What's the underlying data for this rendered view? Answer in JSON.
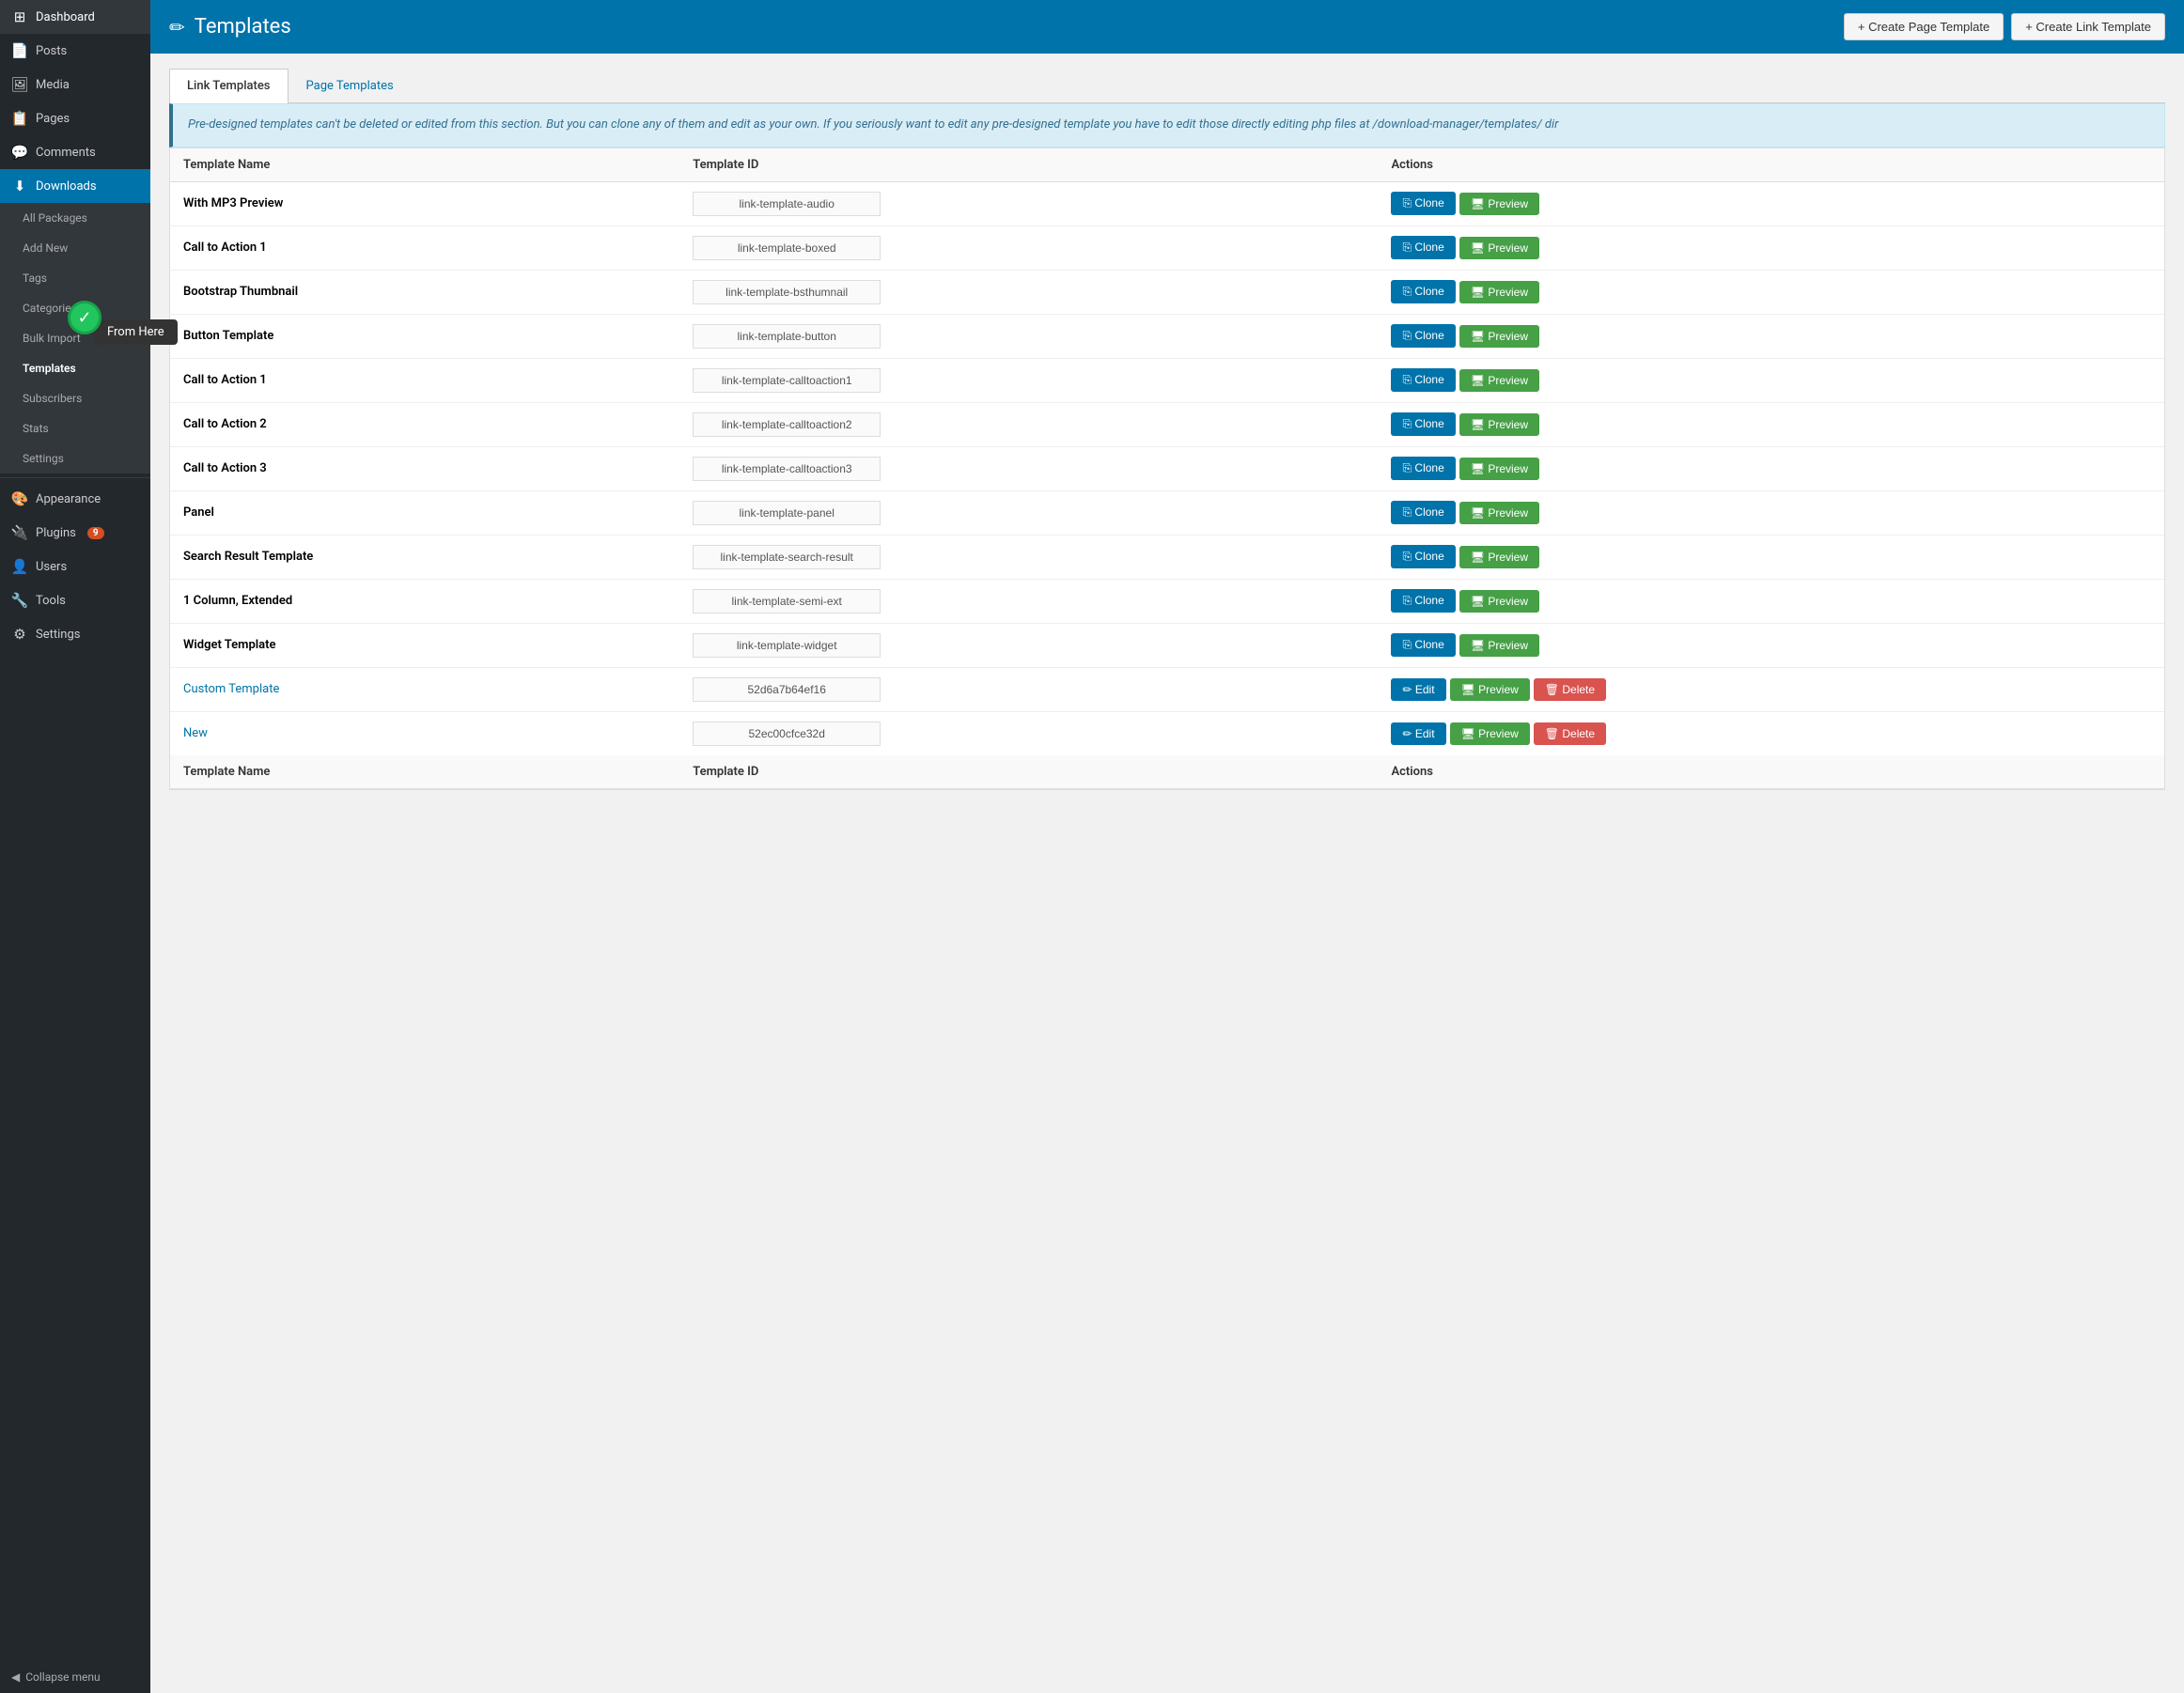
{
  "sidebar": {
    "items": [
      {
        "id": "dashboard",
        "label": "Dashboard",
        "icon": "⊞",
        "active": false
      },
      {
        "id": "posts",
        "label": "Posts",
        "icon": "📄",
        "active": false
      },
      {
        "id": "media",
        "label": "Media",
        "icon": "🖼",
        "active": false
      },
      {
        "id": "pages",
        "label": "Pages",
        "icon": "📋",
        "active": false
      },
      {
        "id": "comments",
        "label": "Comments",
        "icon": "💬",
        "active": false
      },
      {
        "id": "downloads",
        "label": "Downloads",
        "icon": "⬇",
        "active": true
      }
    ],
    "downloads_submenu": [
      {
        "id": "all-packages",
        "label": "All Packages"
      },
      {
        "id": "add-new",
        "label": "Add New"
      },
      {
        "id": "tags",
        "label": "Tags"
      },
      {
        "id": "categories",
        "label": "Categories"
      },
      {
        "id": "bulk-import",
        "label": "Bulk Import"
      },
      {
        "id": "templates",
        "label": "Templates",
        "active": true
      },
      {
        "id": "subscribers",
        "label": "Subscribers"
      },
      {
        "id": "stats",
        "label": "Stats"
      },
      {
        "id": "settings",
        "label": "Settings"
      }
    ],
    "bottom_items": [
      {
        "id": "appearance",
        "label": "Appearance",
        "icon": "🎨"
      },
      {
        "id": "plugins",
        "label": "Plugins",
        "icon": "🔌",
        "badge": "9"
      },
      {
        "id": "users",
        "label": "Users",
        "icon": "👤"
      },
      {
        "id": "tools",
        "label": "Tools",
        "icon": "🔧"
      },
      {
        "id": "settings",
        "label": "Settings",
        "icon": "⚙"
      }
    ],
    "collapse_label": "Collapse menu"
  },
  "header": {
    "icon": "✏",
    "title": "Templates",
    "create_page_template_label": "+ Create Page Template",
    "create_link_template_label": "+ Create Link Template"
  },
  "tabs": [
    {
      "id": "link-templates",
      "label": "Link Templates",
      "active": true
    },
    {
      "id": "page-templates",
      "label": "Page Templates",
      "active": false
    }
  ],
  "notice": {
    "text": "Pre-designed templates can't be deleted or edited from this section. But you can clone any of them and edit as your own. If you seriously want to edit any pre-designed template you have to edit those directly editing php files at /download-manager/templates/ dir"
  },
  "table": {
    "columns": [
      "Template Name",
      "Template ID",
      "Actions"
    ],
    "rows": [
      {
        "id": "row1",
        "name": "With MP3 Preview",
        "template_id": "link-template-audio",
        "type": "predesigned"
      },
      {
        "id": "row2",
        "name": "Call to Action 1",
        "template_id": "link-template-boxed",
        "type": "predesigned"
      },
      {
        "id": "row3",
        "name": "Bootstrap Thumbnail",
        "template_id": "link-template-bsthumnail",
        "type": "predesigned"
      },
      {
        "id": "row4",
        "name": "Button Template",
        "template_id": "link-template-button",
        "type": "predesigned"
      },
      {
        "id": "row5",
        "name": "Call to Action 1",
        "template_id": "link-template-calltoaction1",
        "type": "predesigned"
      },
      {
        "id": "row6",
        "name": "Call to Action 2",
        "template_id": "link-template-calltoaction2",
        "type": "predesigned"
      },
      {
        "id": "row7",
        "name": "Call to Action 3",
        "template_id": "link-template-calltoaction3",
        "type": "predesigned"
      },
      {
        "id": "row8",
        "name": "Panel",
        "template_id": "link-template-panel",
        "type": "predesigned"
      },
      {
        "id": "row9",
        "name": "Search Result Template",
        "template_id": "link-template-search-result",
        "type": "predesigned"
      },
      {
        "id": "row10",
        "name": "1 Column, Extended",
        "template_id": "link-template-semi-ext",
        "type": "predesigned"
      },
      {
        "id": "row11",
        "name": "Widget Template",
        "template_id": "link-template-widget",
        "type": "predesigned"
      },
      {
        "id": "row12",
        "name": "Custom Template",
        "template_id": "52d6a7b64ef16",
        "type": "custom"
      },
      {
        "id": "row13",
        "name": "New",
        "template_id": "52ec00cfce32d",
        "type": "custom"
      }
    ],
    "footer_columns": [
      "Template Name",
      "Template ID",
      "Actions"
    ],
    "clone_label": "Clone",
    "preview_label": "Preview",
    "edit_label": "Edit",
    "delete_label": "Delete"
  },
  "tooltip": {
    "label": "From Here"
  }
}
